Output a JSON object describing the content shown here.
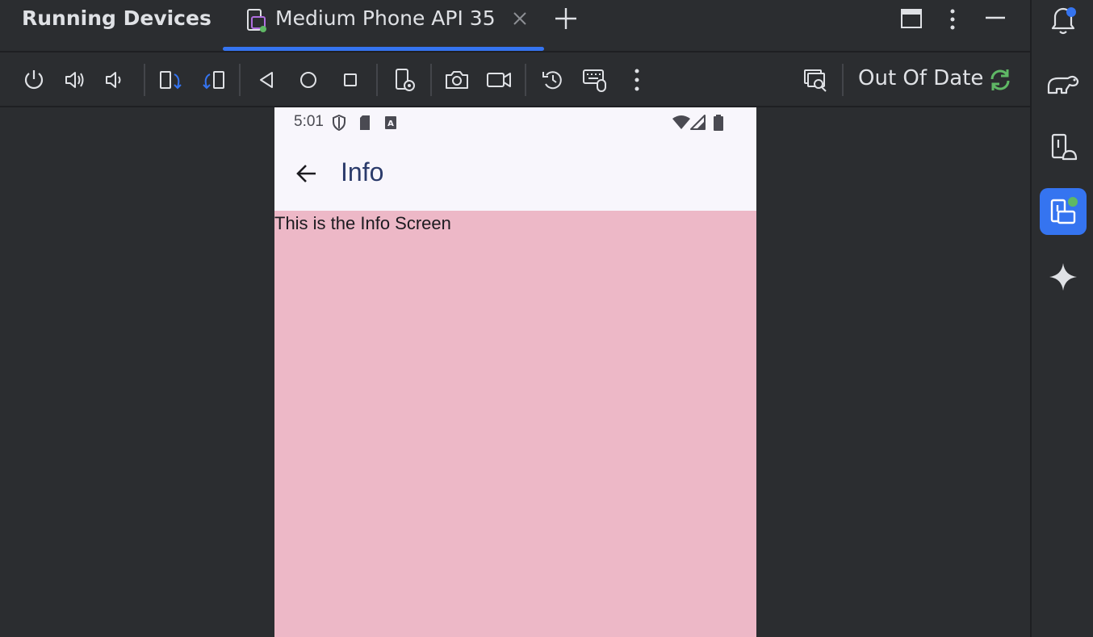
{
  "window": {
    "title": "Running Devices",
    "tab_label": "Medium Phone API 35"
  },
  "toolbar": {
    "icons": [
      "power-icon",
      "volume-up-icon",
      "volume-down-icon",
      "rotate-left-icon",
      "rotate-right-icon",
      "back-icon",
      "home-icon",
      "overview-icon",
      "device-settings-icon",
      "screenshot-icon",
      "screen-record-icon",
      "snapshot-icon",
      "keyboard-mouse-icon",
      "more-icon",
      "device-frame-icon"
    ],
    "status_label": "Out Of Date"
  },
  "device": {
    "status_time": "5:01",
    "app_title": "Info",
    "content_text": "This is the Info Screen",
    "background_color": "#edb8c7"
  },
  "colors": {
    "accent": "#3574f0",
    "sync_green": "#5fb865",
    "notification_blue": "#3574f0"
  }
}
